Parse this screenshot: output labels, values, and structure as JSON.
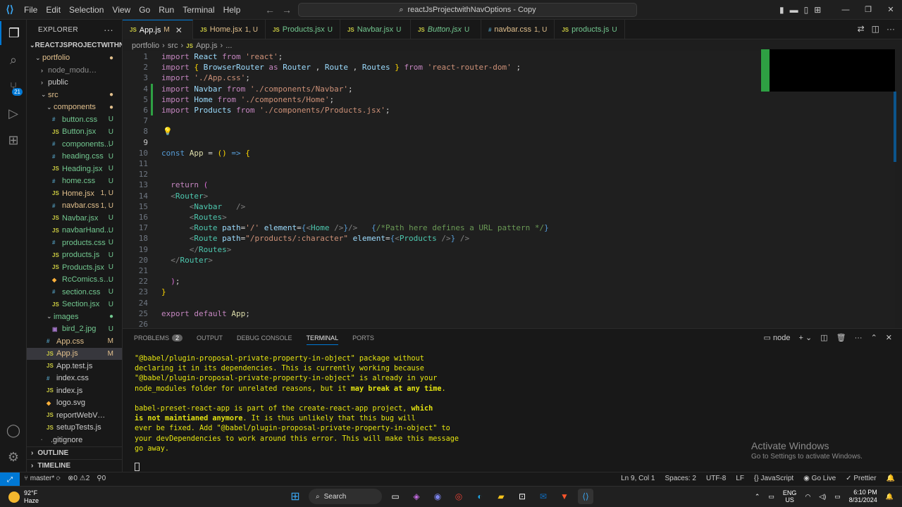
{
  "window": {
    "menu": [
      "File",
      "Edit",
      "Selection",
      "View",
      "Go",
      "Run",
      "Terminal",
      "Help"
    ],
    "command_center": "reactJsProjectwithNavOptions - Copy"
  },
  "activity": {
    "source_control_badge": "21"
  },
  "explorer": {
    "title": "EXPLORER",
    "root": "REACTJSPROJECTWITHNA...",
    "rows": [
      {
        "name": "portfolio",
        "type": "folder-open",
        "indent": 1,
        "color": "mod",
        "status": "●"
      },
      {
        "name": "node_modules",
        "type": "folder",
        "indent": 2,
        "color": "dim",
        "status": ""
      },
      {
        "name": "public",
        "type": "folder",
        "indent": 2,
        "color": "",
        "status": ""
      },
      {
        "name": "src",
        "type": "folder-open",
        "indent": 2,
        "color": "mod",
        "status": "●"
      },
      {
        "name": "components",
        "type": "folder-open",
        "indent": 3,
        "color": "mod",
        "status": "●"
      },
      {
        "name": "button.css",
        "type": "css",
        "indent": 4,
        "color": "unt",
        "status": "U"
      },
      {
        "name": "Button.jsx",
        "type": "js",
        "indent": 4,
        "color": "unt",
        "status": "U"
      },
      {
        "name": "components...",
        "type": "css",
        "indent": 4,
        "color": "unt",
        "status": "U"
      },
      {
        "name": "heading.css",
        "type": "css",
        "indent": 4,
        "color": "unt",
        "status": "U"
      },
      {
        "name": "Heading.jsx",
        "type": "js",
        "indent": 4,
        "color": "unt",
        "status": "U"
      },
      {
        "name": "home.css",
        "type": "css",
        "indent": 4,
        "color": "unt",
        "status": "U"
      },
      {
        "name": "Home.jsx",
        "type": "js",
        "indent": 4,
        "color": "mod",
        "status": "1, U"
      },
      {
        "name": "navbar.css",
        "type": "css",
        "indent": 4,
        "color": "mod",
        "status": "1, U"
      },
      {
        "name": "Navbar.jsx",
        "type": "js",
        "indent": 4,
        "color": "unt",
        "status": "U"
      },
      {
        "name": "navbarHand...",
        "type": "js",
        "indent": 4,
        "color": "unt",
        "status": "U"
      },
      {
        "name": "products.css",
        "type": "css",
        "indent": 4,
        "color": "unt",
        "status": "U"
      },
      {
        "name": "products.js",
        "type": "js",
        "indent": 4,
        "color": "unt",
        "status": "U"
      },
      {
        "name": "Products.jsx",
        "type": "js",
        "indent": 4,
        "color": "unt",
        "status": "U"
      },
      {
        "name": "RcComics.svg",
        "type": "svg",
        "indent": 4,
        "color": "unt",
        "status": "U"
      },
      {
        "name": "section.css",
        "type": "css",
        "indent": 4,
        "color": "unt",
        "status": "U"
      },
      {
        "name": "Section.jsx",
        "type": "js",
        "indent": 4,
        "color": "unt",
        "status": "U"
      },
      {
        "name": "images",
        "type": "folder-open",
        "indent": 3,
        "color": "unt",
        "status": "●"
      },
      {
        "name": "bird_2.jpg",
        "type": "img",
        "indent": 4,
        "color": "unt",
        "status": "U"
      },
      {
        "name": "App.css",
        "type": "css",
        "indent": 3,
        "color": "mod",
        "status": "M"
      },
      {
        "name": "App.js",
        "type": "js",
        "indent": 3,
        "color": "mod",
        "status": "M",
        "selected": true
      },
      {
        "name": "App.test.js",
        "type": "js",
        "indent": 3,
        "color": "",
        "status": ""
      },
      {
        "name": "index.css",
        "type": "css",
        "indent": 3,
        "color": "",
        "status": ""
      },
      {
        "name": "index.js",
        "type": "js",
        "indent": 3,
        "color": "",
        "status": ""
      },
      {
        "name": "logo.svg",
        "type": "svg",
        "indent": 3,
        "color": "",
        "status": ""
      },
      {
        "name": "reportWebVitals.js",
        "type": "js",
        "indent": 3,
        "color": "",
        "status": ""
      },
      {
        "name": "setupTests.js",
        "type": "js",
        "indent": 3,
        "color": "",
        "status": ""
      },
      {
        "name": ".gitignore",
        "type": "txt",
        "indent": 2,
        "color": "",
        "status": ""
      }
    ],
    "outline": "OUTLINE",
    "timeline": "TIMELINE"
  },
  "tabs": [
    {
      "icon": "JS",
      "label": "App.js",
      "status": "M",
      "active": true
    },
    {
      "icon": "JS",
      "label": "Home.jsx",
      "status": "1, U"
    },
    {
      "icon": "JS",
      "label": "Products.jsx",
      "status": "U"
    },
    {
      "icon": "JS",
      "label": "Navbar.jsx",
      "status": "U"
    },
    {
      "icon": "JS",
      "label": "Button.jsx",
      "status": "U",
      "italic": true
    },
    {
      "icon": "#",
      "label": "navbar.css",
      "status": "1, U"
    },
    {
      "icon": "JS",
      "label": "products.js",
      "status": "U"
    }
  ],
  "breadcrumb": [
    "portfolio",
    "›",
    "src",
    "›",
    "JS",
    "App.js",
    "›",
    "..."
  ],
  "code": [
    {
      "n": "1",
      "html": "<span class='k'>import</span> <span class='v'>React</span> <span class='k'>from</span> <span class='s'>'react'</span><span class='p'>;</span>"
    },
    {
      "n": "2",
      "html": "<span class='k'>import</span> <span class='br'>{</span> <span class='v'>BrowserRouter</span> <span class='k'>as</span> <span class='v'>Router</span> <span class='p'>,</span> <span class='v'>Route</span> <span class='p'>,</span> <span class='v'>Routes</span> <span class='br'>}</span> <span class='k'>from</span> <span class='s'>'react-router-dom'</span> <span class='p'>;</span>"
    },
    {
      "n": "3",
      "html": "<span class='k'>import</span> <span class='s'>'./App.css'</span><span class='p'>;</span>"
    },
    {
      "n": "4",
      "html": "<span class='k'>import</span> <span class='v'>Navbar</span> <span class='k'>from</span> <span class='s'>'./components/Navbar'</span><span class='p'>;</span>"
    },
    {
      "n": "5",
      "html": "<span class='k'>import</span> <span class='v'>Home</span> <span class='k'>from</span> <span class='s'>'./components/Home'</span><span class='p'>;</span>"
    },
    {
      "n": "6",
      "html": "<span class='k'>import</span> <span class='v'>Products</span> <span class='k'>from</span> <span class='s'>'./components/Products.jsx'</span><span class='p'>;</span>"
    },
    {
      "n": "7",
      "html": ""
    },
    {
      "n": "8",
      "html": "<span style='color:#ffcc00'>💡</span>"
    },
    {
      "n": "9",
      "html": ""
    },
    {
      "n": "10",
      "html": "<span class='t'>const</span> <span class='fn'>App</span> <span class='p'>=</span> <span class='br'>()</span> <span class='t'>=&gt;</span> <span class='br'>{</span>"
    },
    {
      "n": "11",
      "html": ""
    },
    {
      "n": "12",
      "html": ""
    },
    {
      "n": "13",
      "html": "  <span class='k'>return</span> <span class='br2'>(</span>"
    },
    {
      "n": "14",
      "html": "  <span class='d'>&lt;</span><span class='tag'>Router</span><span class='d'>&gt;</span>"
    },
    {
      "n": "15",
      "html": "      <span class='d'>&lt;</span><span class='tag'>Navbar</span>   <span class='d'>/&gt;</span>"
    },
    {
      "n": "16",
      "html": "      <span class='d'>&lt;</span><span class='tag'>Routes</span><span class='d'>&gt;</span>"
    },
    {
      "n": "17",
      "html": "      <span class='d'>&lt;</span><span class='tag'>Route</span> <span class='v'>path</span><span class='p'>=</span><span class='s'>'/'</span> <span class='v'>element</span><span class='p'>=</span><span class='t'>{</span><span class='d'>&lt;</span><span class='tag'>Home</span> <span class='d'>/&gt;</span><span class='t'>}</span><span class='d'>/&gt;</span>   <span class='t'>{</span><span class='cm'>/*Path here defines a URL pattern */</span><span class='t'>}</span>"
    },
    {
      "n": "18",
      "html": "      <span class='d'>&lt;</span><span class='tag'>Route</span> <span class='v'>path</span><span class='p'>=</span><span class='s'>\"/products/:character\"</span> <span class='v'>element</span><span class='p'>=</span><span class='t'>{</span><span class='d'>&lt;</span><span class='tag'>Products</span> <span class='d'>/&gt;</span><span class='t'>}</span> <span class='d'>/&gt;</span>"
    },
    {
      "n": "19",
      "html": "      <span class='d'>&lt;/</span><span class='tag'>Routes</span><span class='d'>&gt;</span>"
    },
    {
      "n": "20",
      "html": "  <span class='d'>&lt;/</span><span class='tag'>Router</span><span class='d'>&gt;</span>"
    },
    {
      "n": "21",
      "html": ""
    },
    {
      "n": "22",
      "html": "  <span class='br2'>)</span><span class='p'>;</span>"
    },
    {
      "n": "23",
      "html": "<span class='br'>}</span>"
    },
    {
      "n": "24",
      "html": ""
    },
    {
      "n": "25",
      "html": "<span class='k'>export</span> <span class='k'>default</span> <span class='fn'>App</span><span class='p'>;</span>"
    },
    {
      "n": "26",
      "html": ""
    }
  ],
  "panel": {
    "tabs": [
      "PROBLEMS",
      "OUTPUT",
      "DEBUG CONSOLE",
      "TERMINAL",
      "PORTS"
    ],
    "problems_count": "2",
    "shell": "node",
    "terminal_lines": [
      "\"@babel/plugin-proposal-private-property-in-object\" package without",
      "declaring it in its dependencies. This is currently working because",
      "\"@babel/plugin-proposal-private-property-in-object\" is already in your",
      "node_modules folder for unrelated reasons, but it <b>may break at any time</b>.",
      "",
      "babel-preset-react-app is part of the create-react-app project, <b>which</b>",
      "<b>is not maintianed anymore</b>. It is thus unlikely that this bug will",
      "ever be fixed. Add \"@babel/plugin-proposal-private-property-in-object\" to",
      "your devDependencies to work around this error. This will make this message",
      "go away."
    ]
  },
  "watermark": {
    "line1": "Activate Windows",
    "line2": "Go to Settings to activate Windows."
  },
  "statusbar": {
    "branch": "master*",
    "errors": "0",
    "warnings": "2",
    "ports": "0",
    "position": "Ln 9, Col 1",
    "spaces": "Spaces: 2",
    "encoding": "UTF-8",
    "eol": "LF",
    "language": "JavaScript",
    "golive": "Go Live",
    "prettier": "Prettier"
  },
  "taskbar": {
    "temp": "92°F",
    "condition": "Haze",
    "search": "Search",
    "lang1": "ENG",
    "lang2": "US",
    "time": "6:10 PM",
    "date": "8/31/2024"
  }
}
